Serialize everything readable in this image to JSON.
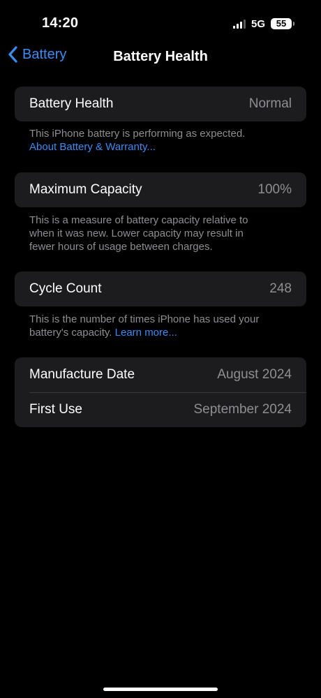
{
  "status_bar": {
    "time": "14:20",
    "network": "5G",
    "battery_level": "55",
    "signal_bars_active": 3,
    "signal_bars_total": 4
  },
  "nav": {
    "back_label": "Battery",
    "title": "Battery Health"
  },
  "health": {
    "label": "Battery Health",
    "value": "Normal",
    "footer_text": "This iPhone battery is performing as expected.",
    "footer_link": "About Battery & Warranty..."
  },
  "capacity": {
    "label": "Maximum Capacity",
    "value": "100%",
    "footer_line1": "This is a measure of battery capacity relative to",
    "footer_line2": "when it was new. Lower capacity may result in",
    "footer_line3": "fewer hours of usage between charges."
  },
  "cycle": {
    "label": "Cycle Count",
    "value": "248",
    "footer_line1": "This is the number of times iPhone has used your",
    "footer_line2": "battery's capacity.",
    "footer_link": "Learn more..."
  },
  "dates": {
    "manufacture_label": "Manufacture Date",
    "manufacture_value": "August 2024",
    "first_use_label": "First Use",
    "first_use_value": "September 2024"
  },
  "colors": {
    "background": "#000000",
    "cell_background": "#1c1c1e",
    "accent": "#3a8cf5",
    "secondary_text": "#8e8e93"
  }
}
